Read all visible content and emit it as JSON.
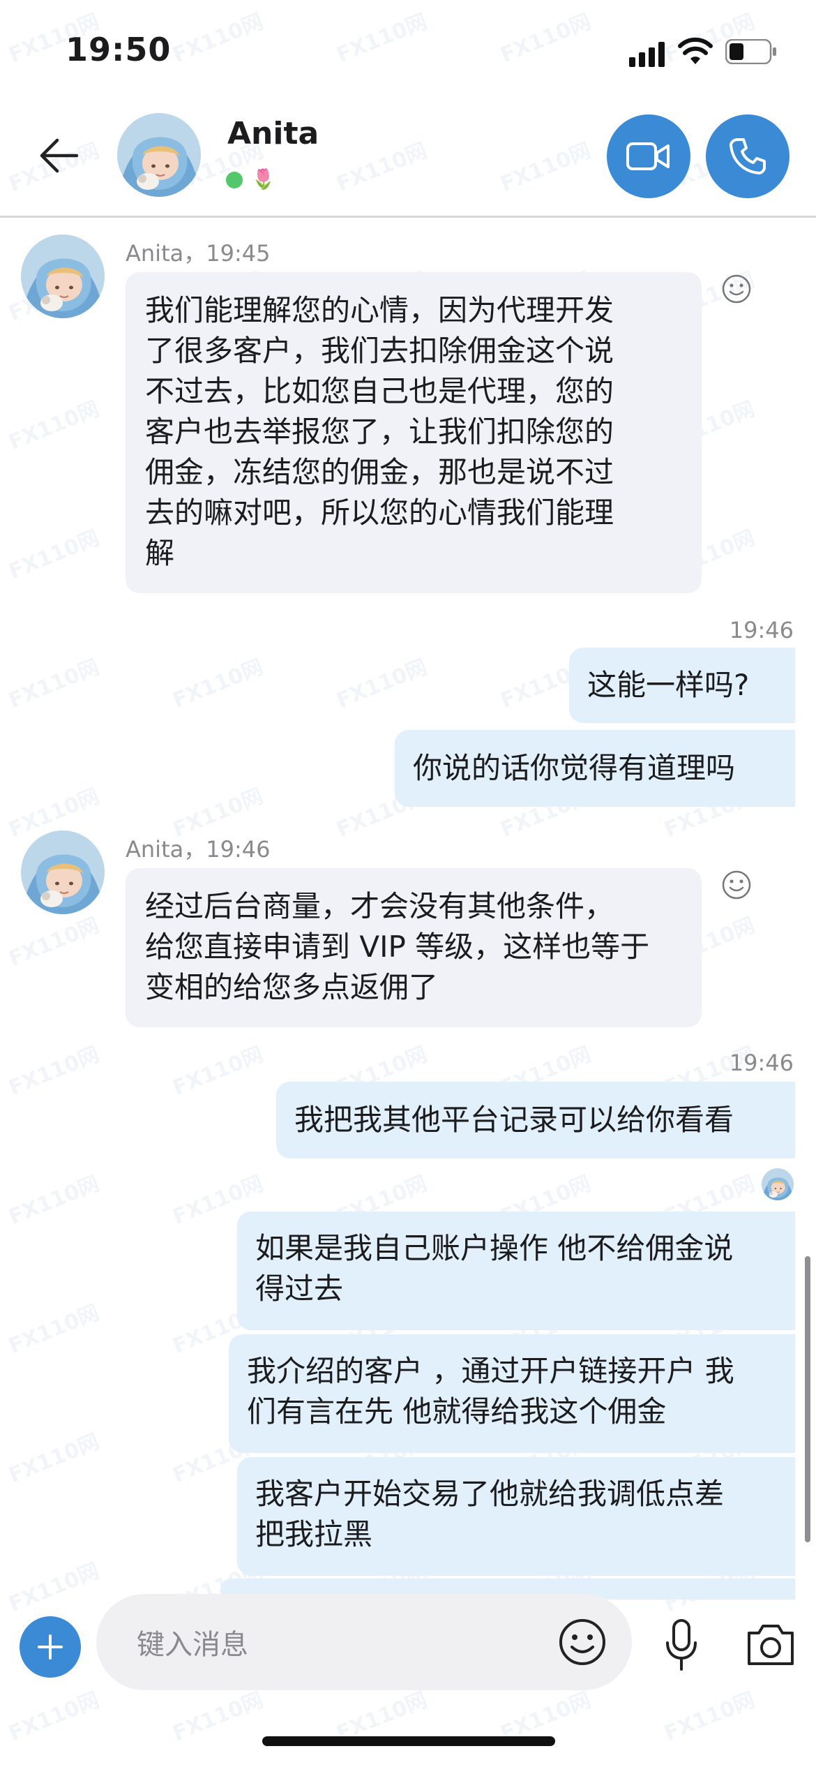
{
  "status_bar": {
    "time": "19:50"
  },
  "header": {
    "back_icon": "arrow-left-icon",
    "name": "Anita",
    "status_emoji": "🌷",
    "video_call_icon": "video-camera-icon",
    "voice_call_icon": "phone-icon"
  },
  "messages": [
    {
      "direction": "in",
      "sender_line": "Anita，19:45",
      "text": "我们能理解您的心情，因为代理开发\n了很多客户，我们去扣除佣金这个说\n不过去，比如您自己也是代理，您的\n客户也去举报您了，让我们扣除您的\n佣金，冻结您的佣金，那也是说不过\n去的嘛对吧，所以您的心情我们能理\n解"
    },
    {
      "direction": "out",
      "time": "19:46",
      "text": "这能一样吗?"
    },
    {
      "direction": "out",
      "text": "你说的话你觉得有道理吗"
    },
    {
      "direction": "in",
      "sender_line": "Anita，19:46",
      "text": "经过后台商量，才会没有其他条件，\n给您直接申请到 VIP 等级，这样也等于\n变相的给您多点返佣了"
    },
    {
      "direction": "out",
      "time": "19:46",
      "text": "我把我其他平台记录可以给你看看"
    },
    {
      "direction": "out",
      "text": "如果是我自己账户操作 他不给佣金说\n得过去"
    },
    {
      "direction": "out",
      "text": "我介绍的客户 ，通过开户链接开户 我\n们有言在先 他就得给我这个佣金"
    },
    {
      "direction": "out",
      "text": "我客户开始交易了他就给我调低点差\n把我拉黑"
    }
  ],
  "input_bar": {
    "placeholder": "键入消息",
    "add_icon": "plus-icon",
    "emoji_icon": "smiley-icon",
    "mic_icon": "microphone-icon",
    "camera_icon": "camera-icon"
  },
  "colors": {
    "accent": "#3b8ad6",
    "incoming_bubble": "#f0f2f7",
    "outgoing_bubble": "#e2f0fb",
    "online": "#52c86a"
  },
  "watermark": "FX110网"
}
